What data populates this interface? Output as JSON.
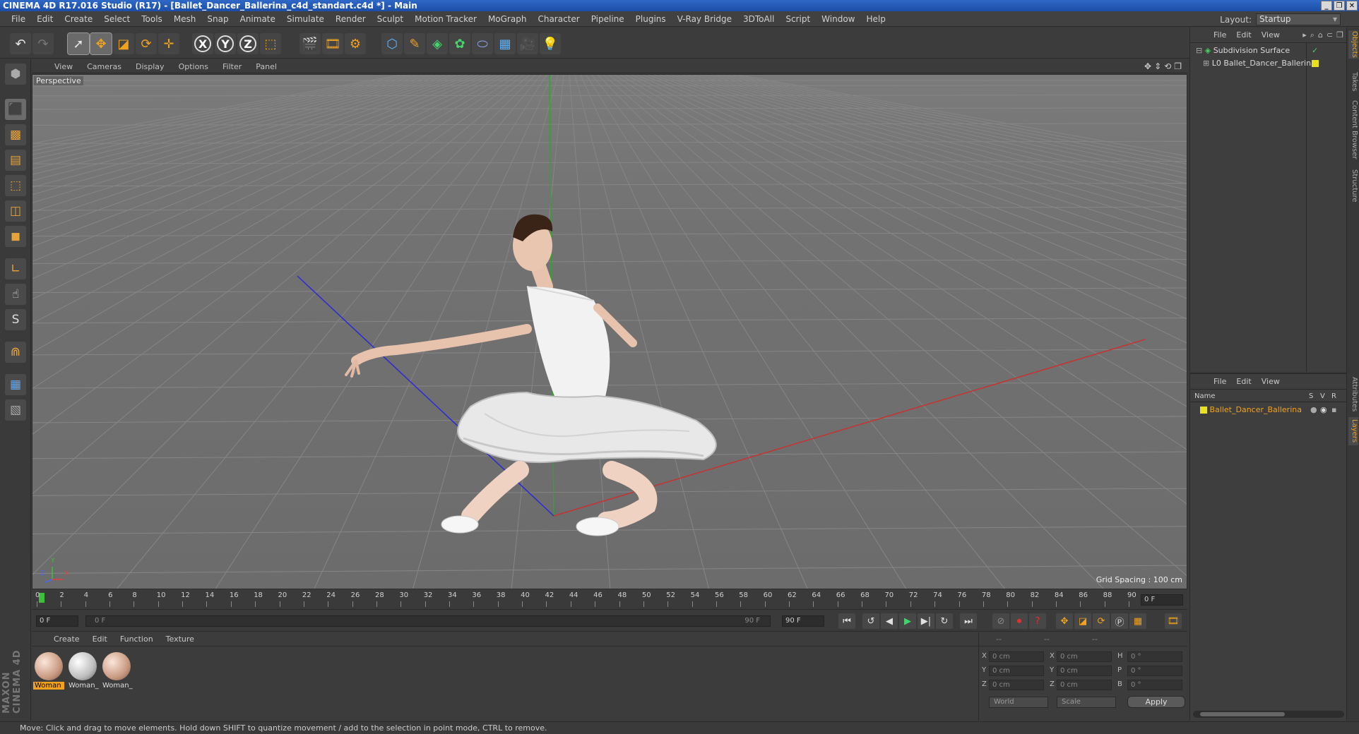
{
  "window": {
    "title": "CINEMA 4D R17.016 Studio (R17) - [Ballet_Dancer_Ballerina_c4d_standart.c4d *] - Main",
    "controls": [
      "_",
      "❐",
      "✕"
    ]
  },
  "menubar": {
    "items": [
      "File",
      "Edit",
      "Create",
      "Select",
      "Tools",
      "Mesh",
      "Snap",
      "Animate",
      "Simulate",
      "Render",
      "Sculpt",
      "Motion Tracker",
      "MoGraph",
      "Character",
      "Pipeline",
      "Plugins",
      "V-Ray Bridge",
      "3DToAll",
      "Script",
      "Window",
      "Help"
    ],
    "layout_label": "Layout:",
    "layout_value": "Startup"
  },
  "toolbar": {
    "icons": [
      "undo-icon",
      "redo-icon",
      "live-selection-icon",
      "move-icon",
      "scale-icon",
      "rotate-icon",
      "transform-icon",
      "x-axis-icon",
      "y-axis-icon",
      "z-axis-icon",
      "coordinate-system-icon",
      "render-view-icon",
      "render-picture-viewer-icon",
      "render-settings-icon",
      "cube-primitive-icon",
      "pen-spline-icon",
      "subdivision-surface-icon",
      "cloner-icon",
      "deformer-icon",
      "floor-icon",
      "camera-icon",
      "light-icon"
    ],
    "axis_labels": [
      "X",
      "Y",
      "Z"
    ]
  },
  "left_tools": {
    "icons": [
      "make-editable-icon",
      "model-mode-icon",
      "texture-mode-icon",
      "workplane-icon",
      "points-mode-icon",
      "edges-mode-icon",
      "polygons-mode-icon",
      "axis-mode-icon",
      "tweak-mode-icon",
      "solo-icon",
      "snap-magnet-icon",
      "layer-lock-icon",
      "layer-animate-icon"
    ],
    "solo_label": "S",
    "brand": "MAXON CINEMA 4D"
  },
  "viewport": {
    "menu": [
      "View",
      "Cameras",
      "Display",
      "Options",
      "Filter",
      "Panel"
    ],
    "nav_icons": [
      "✥",
      "⇕",
      "⟲",
      "❐"
    ],
    "camera_label": "Perspective",
    "grid_spacing": "Grid Spacing : 100 cm",
    "axis_gizmo": {
      "x": "X",
      "y": "Y",
      "z": "Z"
    }
  },
  "timeline": {
    "ticks": [
      "0",
      "2",
      "4",
      "6",
      "8",
      "10",
      "12",
      "14",
      "16",
      "18",
      "20",
      "22",
      "24",
      "26",
      "28",
      "30",
      "32",
      "34",
      "36",
      "38",
      "40",
      "42",
      "44",
      "46",
      "48",
      "50",
      "52",
      "54",
      "56",
      "58",
      "60",
      "62",
      "64",
      "66",
      "68",
      "70",
      "72",
      "74",
      "76",
      "78",
      "80",
      "82",
      "84",
      "86",
      "88",
      "90"
    ],
    "current_frame": "0 F",
    "start_frame": "0 F",
    "slider_start": "0 F",
    "slider_end": "90 F",
    "end_frame": "90 F",
    "transport": [
      "⏮",
      "↺",
      "◀",
      "▶",
      "▶|",
      "↻",
      "⏭"
    ]
  },
  "materials": {
    "menu": [
      "Create",
      "Edit",
      "Function",
      "Texture"
    ],
    "items": [
      {
        "name": "Woman",
        "selected": true
      },
      {
        "name": "Woman_",
        "selected": false
      },
      {
        "name": "Woman_",
        "selected": false
      }
    ]
  },
  "coordinates": {
    "header": [
      "--",
      "--",
      "--"
    ],
    "rows": [
      {
        "l1": "X",
        "v1": "0 cm",
        "l2": "X",
        "v2": "0 cm",
        "l3": "H",
        "v3": "0 °"
      },
      {
        "l1": "Y",
        "v1": "0 cm",
        "l2": "Y",
        "v2": "0 cm",
        "l3": "P",
        "v3": "0 °"
      },
      {
        "l1": "Z",
        "v1": "0 cm",
        "l2": "Z",
        "v2": "0 cm",
        "l3": "B",
        "v3": "0 °"
      }
    ],
    "mode": "World",
    "transform": "Scale",
    "apply": "Apply"
  },
  "object_manager": {
    "menu": [
      "File",
      "Edit",
      "View"
    ],
    "objects": [
      {
        "name": "Subdivision Surface",
        "indent": 0
      },
      {
        "name": "Ballet_Dancer_Ballerina",
        "indent": 1
      }
    ]
  },
  "layer_manager": {
    "menu": [
      "File",
      "Edit",
      "View"
    ],
    "columns": {
      "name": "Name",
      "s": "S",
      "v": "V",
      "r": "R"
    },
    "layers": [
      {
        "name": "Ballet_Dancer_Ballerina",
        "color": "#e8e020"
      }
    ]
  },
  "side_tabs": [
    "Objects",
    "Takes",
    "Content Browser",
    "Structure",
    "Attributes",
    "Layers"
  ],
  "status": "Move: Click and drag to move elements. Hold down SHIFT to quantize movement / add to the selection in point mode, CTRL to remove.",
  "colors": {
    "accent": "#f0a21e",
    "titlebar": "#2f68c6",
    "layer_yellow": "#e8e020"
  }
}
